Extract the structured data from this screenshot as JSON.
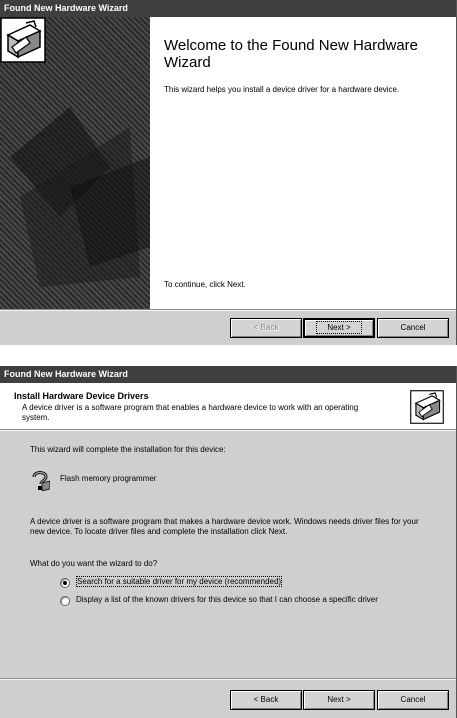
{
  "dialog1": {
    "title": "Found New Hardware Wizard",
    "heading": "Welcome to the Found New Hardware Wizard",
    "body": "This wizard helps you install a device driver for a hardware device.",
    "continue": "To continue, click Next.",
    "buttons": {
      "back": "< Back",
      "next": "Next >",
      "cancel": "Cancel"
    },
    "back_enabled": false
  },
  "dialog2": {
    "title": "Found New Hardware Wizard",
    "header_title": "Install Hardware Device Drivers",
    "header_subtitle": "A device driver is a software program that enables a hardware device to work with an operating system.",
    "complete_text": "This wizard will complete the installation for this device:",
    "device_name": "Flash memory programmer",
    "description": "A device driver is a software program that makes a hardware device work. Windows needs driver files for your new device. To locate driver files and complete the installation click Next.",
    "question": "What do you want the wizard to do?",
    "options": [
      {
        "label": "Search for a suitable driver for my device (recommended)",
        "checked": true
      },
      {
        "label": "Display a list of the known drivers for this device so that I can choose a specific driver",
        "checked": false
      }
    ],
    "buttons": {
      "back": "< Back",
      "next": "Next >",
      "cancel": "Cancel"
    }
  },
  "icons": {
    "wizard": "hardware-wizard-icon",
    "device": "unknown-device-icon"
  },
  "colors": {
    "titlebar": "#3f3f3f",
    "face": "#cfcfcf",
    "content": "#ffffff"
  }
}
